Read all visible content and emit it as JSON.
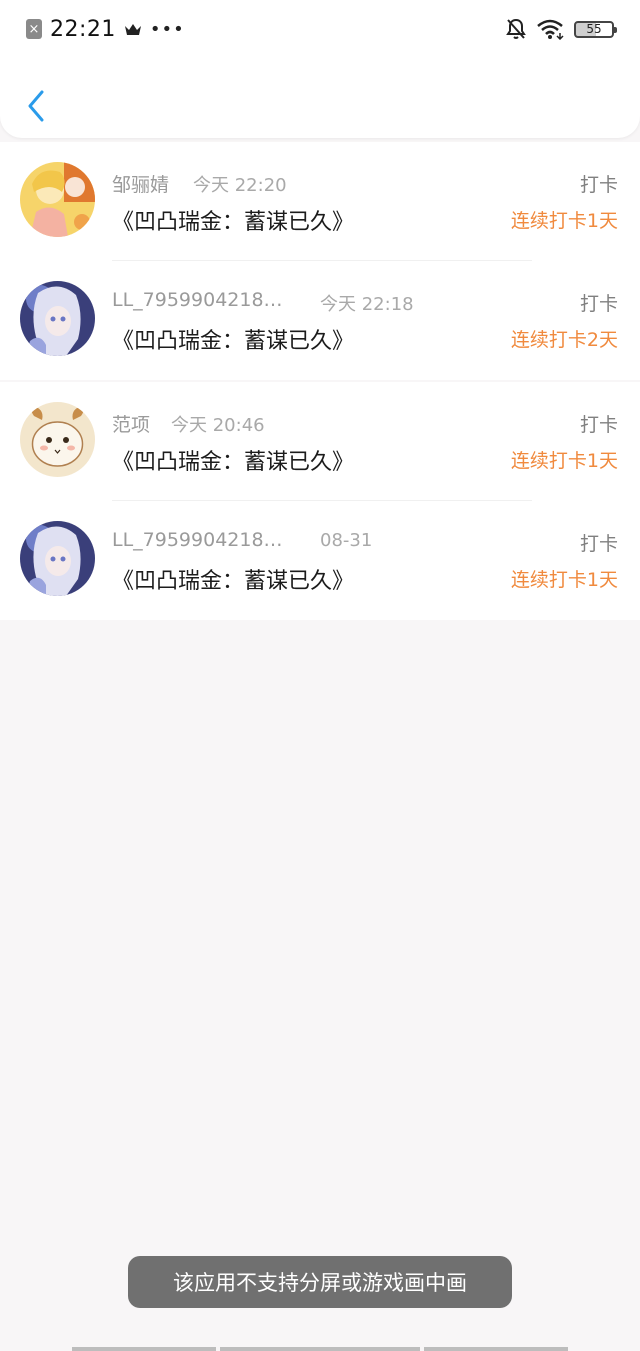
{
  "status_bar": {
    "time": "22:21",
    "dots": "•••",
    "battery": "55",
    "icons": [
      "sim-off-icon",
      "crown-icon",
      "bell-off-icon",
      "wifi-icon",
      "battery-icon"
    ]
  },
  "header": {
    "back_icon": "chevron-left-icon",
    "accent": "#2a9bea"
  },
  "entries": [
    {
      "name": "邹骊婧",
      "time": "今天 22:20",
      "title": "《凹凸瑞金：蓄谋已久》",
      "action": "打卡",
      "streak": "连续打卡1天"
    },
    {
      "name": "LL_7959904218…",
      "time": "今天 22:18",
      "title": "《凹凸瑞金：蓄谋已久》",
      "action": "打卡",
      "streak": "连续打卡2天"
    },
    {
      "name": "范项",
      "time": "今天 20:46",
      "title": "《凹凸瑞金：蓄谋已久》",
      "action": "打卡",
      "streak": "连续打卡1天"
    },
    {
      "name": "LL_7959904218…",
      "time": "08-31",
      "title": "《凹凸瑞金：蓄谋已久》",
      "action": "打卡",
      "streak": "连续打卡1天"
    }
  ],
  "toast": "该应用不支持分屏或游戏画中画",
  "colors": {
    "streak": "#f08a3e",
    "name": "#9a9a9a",
    "title": "#1c1c1c",
    "toast_bg": "#707070"
  }
}
